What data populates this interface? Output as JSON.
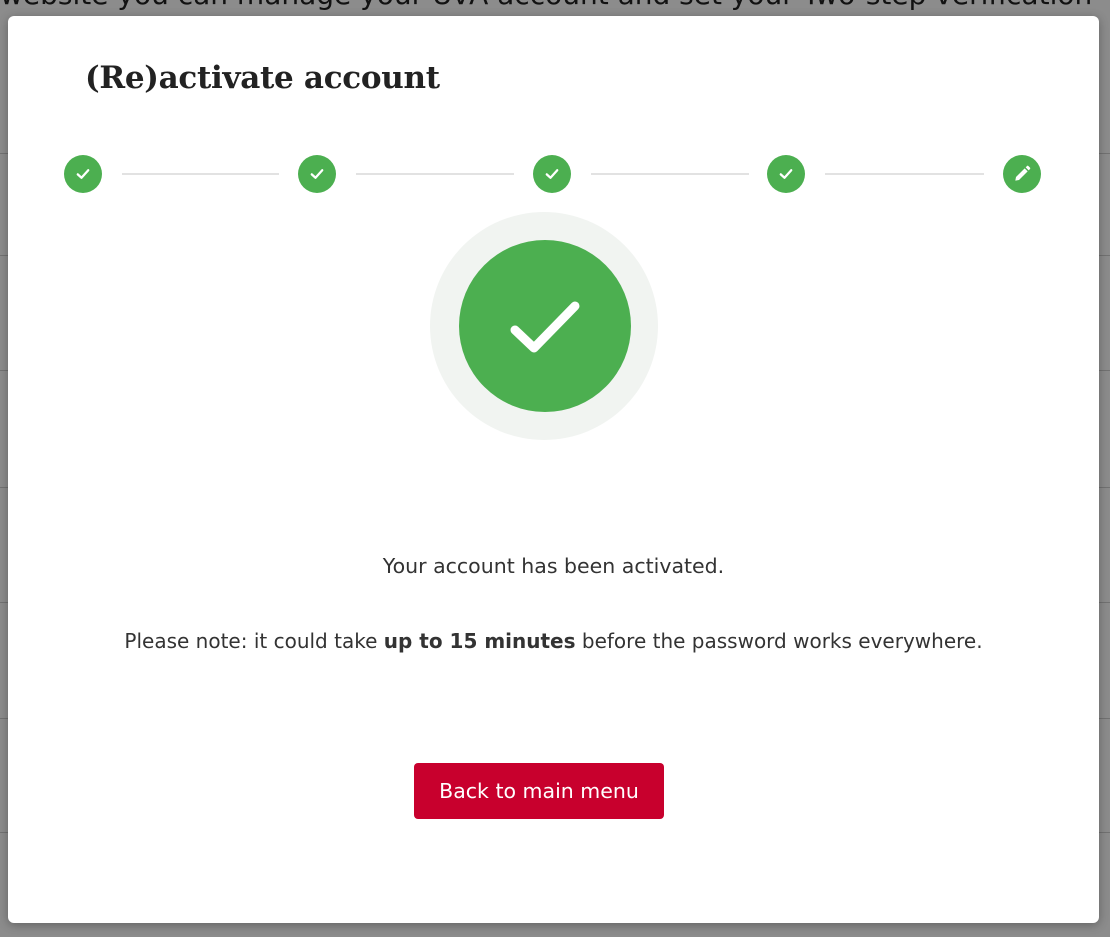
{
  "background": {
    "partial_text": "website you can manage your UvA account and set your Two-step verification"
  },
  "modal": {
    "title": "(Re)activate account",
    "steps": [
      {
        "status": "done",
        "icon": "check-icon"
      },
      {
        "status": "done",
        "icon": "check-icon"
      },
      {
        "status": "done",
        "icon": "check-icon"
      },
      {
        "status": "done",
        "icon": "check-icon"
      },
      {
        "status": "current",
        "icon": "pencil-icon"
      }
    ],
    "success_icon": "check-circle-icon",
    "message": "Your account has been activated.",
    "note": {
      "prefix": "Please note: it could take ",
      "emphasis": "up to 15 minutes",
      "suffix": " before the password works everywhere."
    },
    "back_button_label": "Back to main menu"
  },
  "colors": {
    "success": "#4caf50",
    "primary_button": "#c8002d",
    "stepper_line": "#e2e2e2"
  }
}
